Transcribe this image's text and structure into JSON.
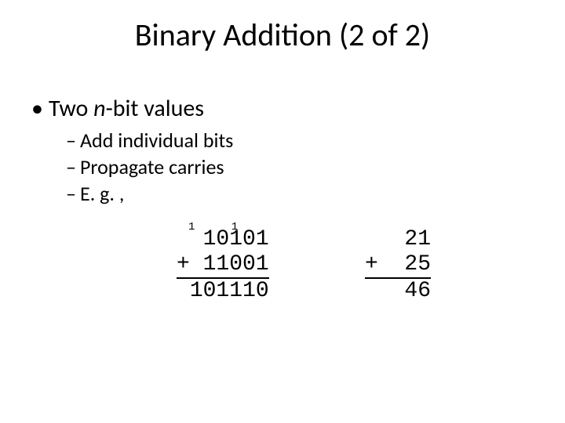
{
  "title": "Binary Addition (2 of 2)",
  "bullets": {
    "main_pre": "Two ",
    "main_italic": "n",
    "main_post": "-bit values",
    "sub": [
      "Add individual bits",
      "Propagate carries",
      "E. g. ,"
    ]
  },
  "carries": "1 1",
  "binary": {
    "a": " 10101",
    "op": "+",
    "b": " 11001",
    "sum": "101110"
  },
  "decimal": {
    "a": "21",
    "op": "+",
    "b": "25",
    "sum": "46"
  },
  "chart_data": {
    "type": "table",
    "title": "Binary addition example with carries",
    "carries_over_columns": [
      1,
      null,
      1,
      null,
      null
    ],
    "operand_a_binary": "10101",
    "operand_b_binary": "11001",
    "sum_binary": "101110",
    "operand_a_decimal": 21,
    "operand_b_decimal": 25,
    "sum_decimal": 46
  }
}
